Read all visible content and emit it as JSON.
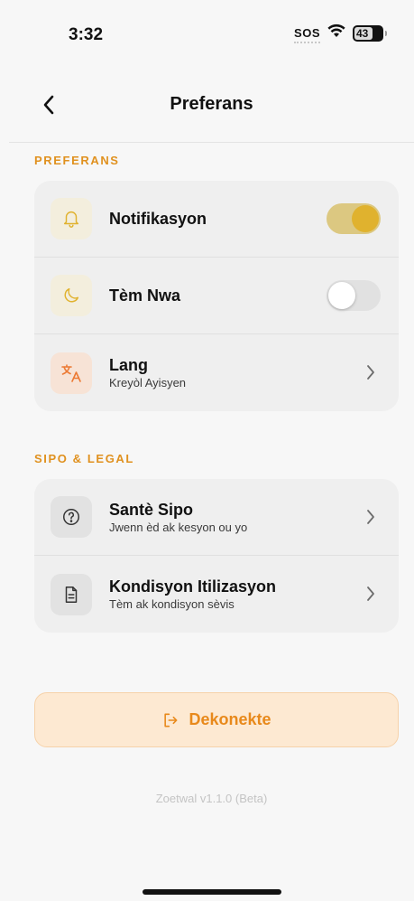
{
  "status_bar": {
    "time": "3:32",
    "sos": "SOS",
    "battery": "43"
  },
  "nav": {
    "title": "Preferans"
  },
  "preferences_section": {
    "label": "PREFERANS",
    "items": [
      {
        "icon": "bell-icon",
        "title": "Notifikasyon",
        "toggle_on": true
      },
      {
        "icon": "moon-icon",
        "title": "Tèm Nwa",
        "toggle_on": false
      },
      {
        "icon": "translate-icon",
        "title": "Lang",
        "subtitle": "Kreyòl Ayisyen"
      }
    ]
  },
  "support_section": {
    "label": "SIPO & LEGAL",
    "items": [
      {
        "icon": "help-circle-icon",
        "title": "Santè Sipo",
        "subtitle": "Jwenn èd ak kesyon ou yo"
      },
      {
        "icon": "document-icon",
        "title": "Kondisyon Itilizasyon",
        "subtitle": "Tèm ak kondisyon sèvis"
      }
    ]
  },
  "logout": {
    "label": "Dekonekte",
    "icon": "logout-icon"
  },
  "footer": {
    "version": "Zoetwal v1.1.0 (Beta)"
  },
  "colors": {
    "accent": "#e8891b",
    "section_label": "#e0911f",
    "toggle_knob_on": "#e0b22e"
  }
}
